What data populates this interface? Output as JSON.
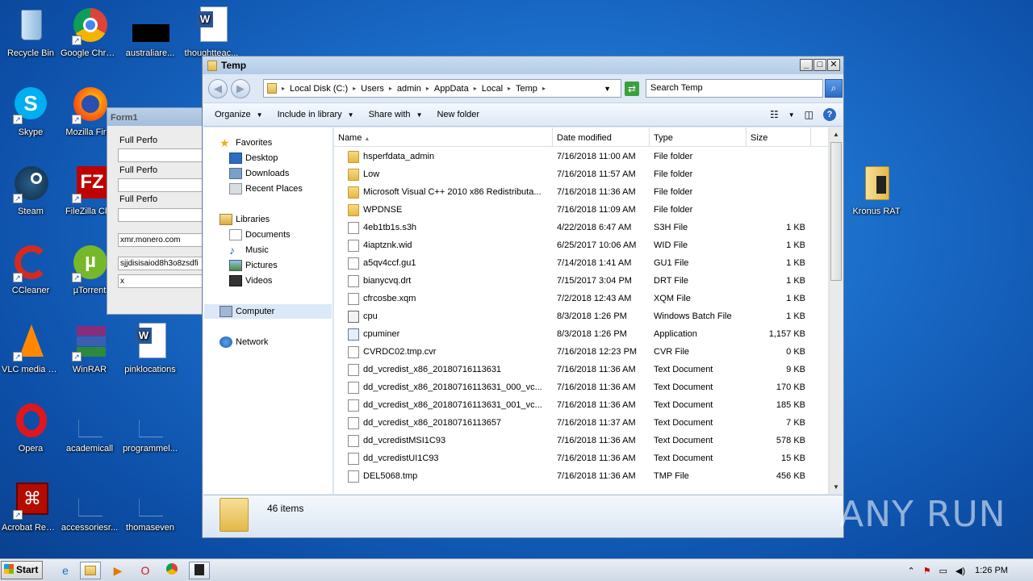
{
  "desktop": {
    "icons": [
      {
        "label": "Recycle Bin"
      },
      {
        "label": "Google Chrome"
      },
      {
        "label": "australiare..."
      },
      {
        "label": "thoughtteac..."
      },
      {
        "label": "Skype"
      },
      {
        "label": "Mozilla Firef"
      },
      {
        "label": "Steam"
      },
      {
        "label": "FileZilla Clie"
      },
      {
        "label": "CCleaner"
      },
      {
        "label": "µTorrent"
      },
      {
        "label": "VLC media player"
      },
      {
        "label": "WinRAR"
      },
      {
        "label": "pinklocations"
      },
      {
        "label": "Opera"
      },
      {
        "label": "academicall"
      },
      {
        "label": "programmel..."
      },
      {
        "label": "Acrobat Reader DC"
      },
      {
        "label": "accessoriesr..."
      },
      {
        "label": "thomaseven"
      },
      {
        "label": "Kronus RAT"
      }
    ]
  },
  "form1": {
    "title": "Form1",
    "fields": [
      {
        "label": "Full Perfo",
        "value": ""
      },
      {
        "label": "Full Perfo",
        "value": ""
      },
      {
        "label": "Full Perfo",
        "value": ""
      },
      {
        "value": "xmr.monero.com"
      },
      {
        "value": "sjjdisisaiod8h3o8zsdfi"
      },
      {
        "value": "x"
      }
    ]
  },
  "explorer": {
    "title": "Temp",
    "breadcrumb": [
      "Local Disk (C:)",
      "Users",
      "admin",
      "AppData",
      "Local",
      "Temp"
    ],
    "search_placeholder": "Search Temp",
    "toolbar": {
      "organize": "Organize",
      "include": "Include in library",
      "share": "Share with",
      "new_folder": "New folder"
    },
    "nav": {
      "favorites": "Favorites",
      "desktop": "Desktop",
      "downloads": "Downloads",
      "recent": "Recent Places",
      "libraries": "Libraries",
      "documents": "Documents",
      "music": "Music",
      "pictures": "Pictures",
      "videos": "Videos",
      "computer": "Computer",
      "network": "Network"
    },
    "columns": {
      "name": "Name",
      "date": "Date modified",
      "type": "Type",
      "size": "Size"
    },
    "files": [
      {
        "name": "hsperfdata_admin",
        "date": "7/16/2018 11:00 AM",
        "type": "File folder",
        "size": "",
        "icon": "folder"
      },
      {
        "name": "Low",
        "date": "7/16/2018 11:57 AM",
        "type": "File folder",
        "size": "",
        "icon": "folder"
      },
      {
        "name": "Microsoft Visual C++ 2010  x86 Redistributa...",
        "date": "7/16/2018 11:36 AM",
        "type": "File folder",
        "size": "",
        "icon": "folder"
      },
      {
        "name": "WPDNSE",
        "date": "7/16/2018 11:09 AM",
        "type": "File folder",
        "size": "",
        "icon": "folder"
      },
      {
        "name": "4eb1tb1s.s3h",
        "date": "4/22/2018 6:47 AM",
        "type": "S3H File",
        "size": "1 KB",
        "icon": "doc"
      },
      {
        "name": "4iaptznk.wid",
        "date": "6/25/2017 10:06 AM",
        "type": "WID File",
        "size": "1 KB",
        "icon": "doc"
      },
      {
        "name": "a5qv4ccf.gu1",
        "date": "7/14/2018 1:41 AM",
        "type": "GU1 File",
        "size": "1 KB",
        "icon": "doc"
      },
      {
        "name": "bianycvq.drt",
        "date": "7/15/2017 3:04 PM",
        "type": "DRT File",
        "size": "1 KB",
        "icon": "doc"
      },
      {
        "name": "cfrcosbe.xqm",
        "date": "7/2/2018 12:43 AM",
        "type": "XQM File",
        "size": "1 KB",
        "icon": "doc"
      },
      {
        "name": "cpu",
        "date": "8/3/2018 1:26 PM",
        "type": "Windows Batch File",
        "size": "1 KB",
        "icon": "bat"
      },
      {
        "name": "cpuminer",
        "date": "8/3/2018 1:26 PM",
        "type": "Application",
        "size": "1,157 KB",
        "icon": "app"
      },
      {
        "name": "CVRDC02.tmp.cvr",
        "date": "7/16/2018 12:23 PM",
        "type": "CVR File",
        "size": "0 KB",
        "icon": "doc"
      },
      {
        "name": "dd_vcredist_x86_20180716113631",
        "date": "7/16/2018 11:36 AM",
        "type": "Text Document",
        "size": "9 KB",
        "icon": "doc"
      },
      {
        "name": "dd_vcredist_x86_20180716113631_000_vc...",
        "date": "7/16/2018 11:36 AM",
        "type": "Text Document",
        "size": "170 KB",
        "icon": "doc"
      },
      {
        "name": "dd_vcredist_x86_20180716113631_001_vc...",
        "date": "7/16/2018 11:36 AM",
        "type": "Text Document",
        "size": "185 KB",
        "icon": "doc"
      },
      {
        "name": "dd_vcredist_x86_20180716113657",
        "date": "7/16/2018 11:37 AM",
        "type": "Text Document",
        "size": "7 KB",
        "icon": "doc"
      },
      {
        "name": "dd_vcredistMSI1C93",
        "date": "7/16/2018 11:36 AM",
        "type": "Text Document",
        "size": "578 KB",
        "icon": "doc"
      },
      {
        "name": "dd_vcredistUI1C93",
        "date": "7/16/2018 11:36 AM",
        "type": "Text Document",
        "size": "15 KB",
        "icon": "doc"
      },
      {
        "name": "DEL5068.tmp",
        "date": "7/16/2018 11:36 AM",
        "type": "TMP File",
        "size": "456 KB",
        "icon": "doc"
      }
    ],
    "status": "46 items"
  },
  "taskbar": {
    "start": "Start",
    "clock": "1:26 PM"
  },
  "watermark": "ANY RUN"
}
